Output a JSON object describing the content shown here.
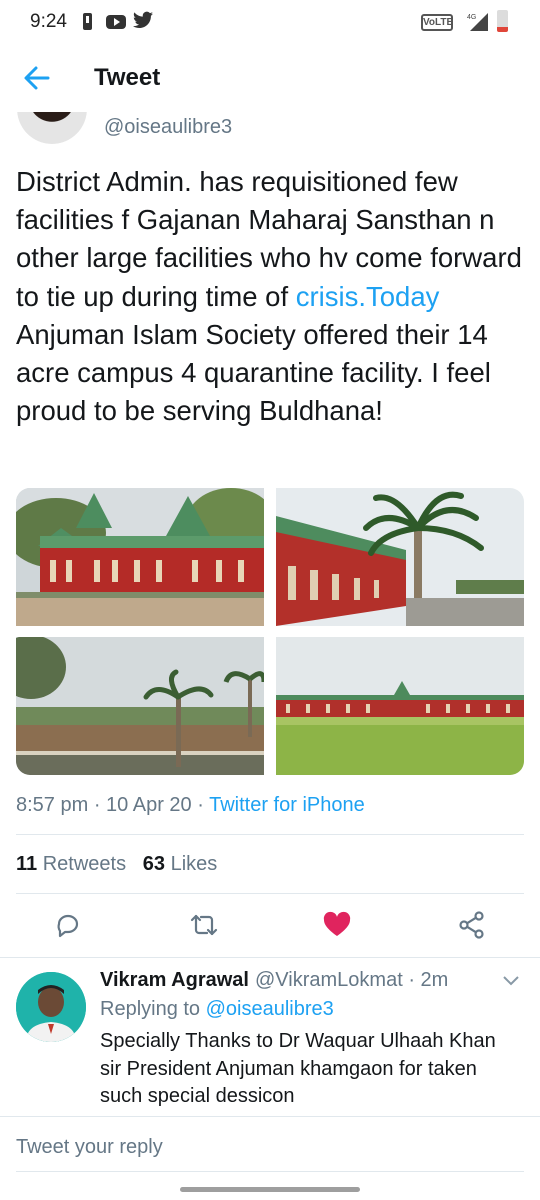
{
  "status_bar": {
    "time": "9:24",
    "network_badge": "VoLTE",
    "network_type": "4G",
    "icons": [
      "alert-icon",
      "youtube-icon",
      "twitter-icon",
      "volte-icon",
      "signal-icon",
      "battery-icon"
    ]
  },
  "header": {
    "title": "Tweet",
    "back_icon": "arrow-left-icon"
  },
  "tweet": {
    "handle": "@oiseaulibre3",
    "text_before_link": "District Admin. has requisitioned few facilities f Gajanan Maharaj Sansthan n other large facilities who hv come forward to tie up during time of ",
    "link_text": "crisis.Today",
    "text_after_link": " Anjuman Islam Society offered their 14 acre campus 4 quarantine facility. I feel proud to be serving Buldhana!",
    "photos": [
      "red-building-photo",
      "palm-tree-building-photo",
      "campus-field-photo",
      "lawn-building-photo"
    ],
    "time": "8:57 pm",
    "separator": " · ",
    "date": "10 Apr 20",
    "source": "Twitter for iPhone",
    "retweets_count": "11",
    "retweets_label": "Retweets",
    "likes_count": "63",
    "likes_label": "Likes",
    "actions": [
      "reply-icon",
      "retweet-icon",
      "like-icon",
      "share-icon"
    ],
    "like_color": "#e0245e"
  },
  "reply": {
    "name": "Vikram Agrawal",
    "handle": "@VikramLokmat",
    "time": "· 2m",
    "replying_to_label": "Replying to ",
    "replying_to_handle": "@oiseaulibre3",
    "text": "Specially Thanks to Dr Waquar Ulhaah Khan sir  President Anjuman khamgaon for taken such special dessicon"
  },
  "compose": {
    "placeholder": "Tweet your reply"
  },
  "colors": {
    "accent": "#1da1f2",
    "secondary_text": "#657786",
    "divider": "#e1e8ed"
  }
}
